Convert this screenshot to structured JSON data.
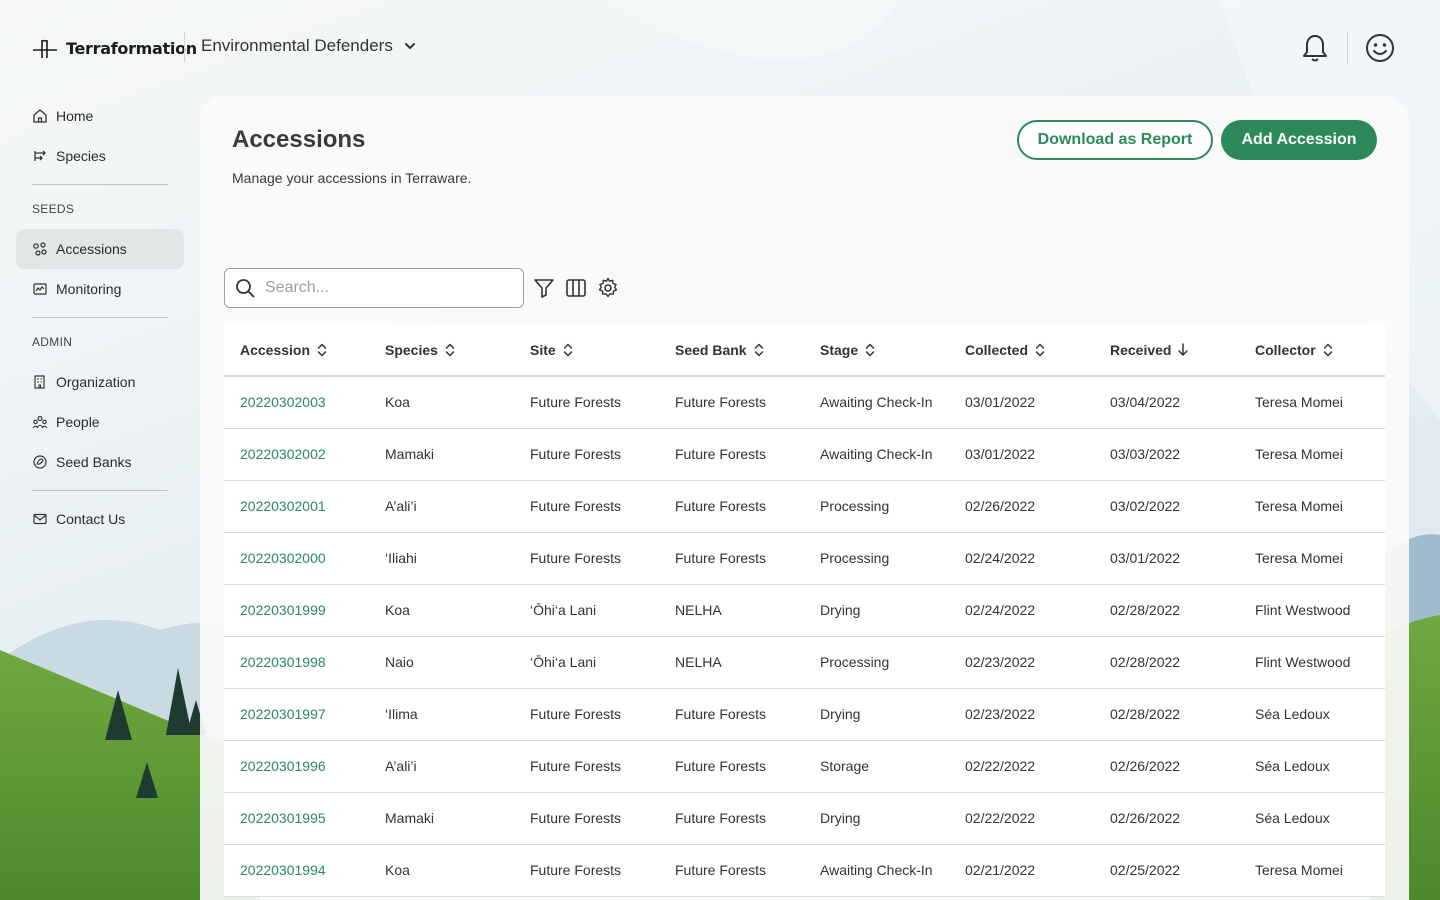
{
  "app": {
    "brand": "Terraformation",
    "org_name": "Environmental Defenders"
  },
  "icons": {
    "bell": "bell-icon",
    "avatar": "smiley-face-icon",
    "org_chevron": "chevron-down-icon"
  },
  "colors": {
    "accent": "#2c8a5a",
    "active_nav": "#e2e6e7"
  },
  "sidebar": {
    "items": [
      {
        "label": "Home",
        "icon": "home-icon"
      },
      {
        "label": "Species",
        "icon": "species-icon"
      }
    ],
    "seeds_heading": "SEEDS",
    "seeds_items": [
      {
        "label": "Accessions",
        "icon": "accessions-icon",
        "active": true
      },
      {
        "label": "Monitoring",
        "icon": "monitoring-icon"
      }
    ],
    "admin_heading": "ADMIN",
    "admin_items": [
      {
        "label": "Organization",
        "icon": "organization-icon"
      },
      {
        "label": "People",
        "icon": "people-icon"
      },
      {
        "label": "Seed Banks",
        "icon": "seed-banks-icon"
      }
    ],
    "footer_items": [
      {
        "label": "Contact Us",
        "icon": "mail-icon"
      }
    ]
  },
  "page": {
    "title": "Accessions",
    "subtitle": "Manage your accessions in Terraware.",
    "download_label": "Download as Report",
    "add_label": "Add Accession"
  },
  "search": {
    "placeholder": "Search..."
  },
  "toolbar": {
    "filter_icon": "filter-icon",
    "columns_icon": "columns-icon",
    "settings_icon": "gear-icon"
  },
  "table": {
    "columns": [
      {
        "label": "Accession",
        "sort": "none"
      },
      {
        "label": "Species",
        "sort": "none"
      },
      {
        "label": "Site",
        "sort": "none"
      },
      {
        "label": "Seed Bank",
        "sort": "none"
      },
      {
        "label": "Stage",
        "sort": "none"
      },
      {
        "label": "Collected",
        "sort": "none"
      },
      {
        "label": "Received",
        "sort": "desc"
      },
      {
        "label": "Collector",
        "sort": "none"
      }
    ],
    "rows": [
      [
        "20220302003",
        "Koa",
        "Future Forests",
        "Future Forests",
        "Awaiting Check-In",
        "03/01/2022",
        "03/04/2022",
        "Teresa Momei"
      ],
      [
        "20220302002",
        "Mamaki",
        "Future Forests",
        "Future Forests",
        "Awaiting Check-In",
        "03/01/2022",
        "03/03/2022",
        "Teresa Momei"
      ],
      [
        "20220302001",
        "A’ali’i",
        "Future Forests",
        "Future Forests",
        "Processing",
        "02/26/2022",
        "03/02/2022",
        "Teresa Momei"
      ],
      [
        "20220302000",
        "‘Iliahi",
        "Future Forests",
        "Future Forests",
        "Processing",
        "02/24/2022",
        "03/01/2022",
        "Teresa Momei"
      ],
      [
        "20220301999",
        "Koa",
        "‘Ōhi‘a Lani",
        "NELHA",
        "Drying",
        "02/24/2022",
        "02/28/2022",
        "Flint Westwood"
      ],
      [
        "20220301998",
        "Naio",
        "‘Ōhi‘a Lani",
        "NELHA",
        "Processing",
        "02/23/2022",
        "02/28/2022",
        "Flint Westwood"
      ],
      [
        "20220301997",
        "‘Ilima",
        "Future Forests",
        "Future Forests",
        "Drying",
        "02/23/2022",
        "02/28/2022",
        "Séa Ledoux"
      ],
      [
        "20220301996",
        "A’ali’i",
        "Future Forests",
        "Future Forests",
        "Storage",
        "02/22/2022",
        "02/26/2022",
        "Séa Ledoux"
      ],
      [
        "20220301995",
        "Mamaki",
        "Future Forests",
        "Future Forests",
        "Drying",
        "02/22/2022",
        "02/26/2022",
        "Séa Ledoux"
      ],
      [
        "20220301994",
        "Koa",
        "Future Forests",
        "Future Forests",
        "Awaiting Check-In",
        "02/21/2022",
        "02/25/2022",
        "Teresa Momei"
      ]
    ]
  }
}
